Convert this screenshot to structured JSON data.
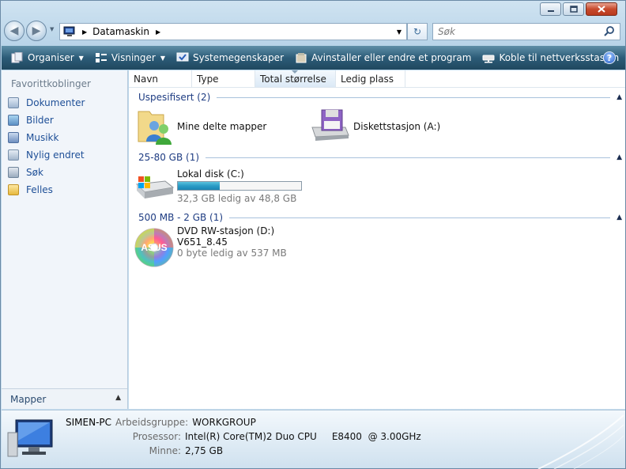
{
  "window": {
    "title": "Datamaskin"
  },
  "address": {
    "segments": [
      "Datamaskin"
    ]
  },
  "search": {
    "placeholder": "Søk"
  },
  "toolbar": {
    "organise": "Organiser",
    "views": "Visninger",
    "system_properties": "Systemegenskaper",
    "uninstall": "Avinstaller eller endre et program",
    "map_drive": "Koble til nettverksstasjon",
    "overflow": "»"
  },
  "sidebar": {
    "header": "Favorittkoblinger",
    "items": [
      {
        "label": "Dokumenter",
        "icon": "documents-icon"
      },
      {
        "label": "Bilder",
        "icon": "pictures-icon"
      },
      {
        "label": "Musikk",
        "icon": "music-icon"
      },
      {
        "label": "Nylig endret",
        "icon": "recent-icon"
      },
      {
        "label": "Søk",
        "icon": "search-icon"
      },
      {
        "label": "Felles",
        "icon": "public-folder-icon"
      }
    ],
    "folders_label": "Mapper"
  },
  "columns": [
    "Navn",
    "Type",
    "Total størrelse",
    "Ledig plass"
  ],
  "groups": [
    {
      "label": "Uspesifisert (2)",
      "items": [
        {
          "name": "Mine delte mapper",
          "icon": "shared-folder-icon"
        },
        {
          "name": "Diskettstasjon (A:)",
          "icon": "floppy-drive-icon"
        }
      ]
    },
    {
      "label": "25-80 GB (1)",
      "items": [
        {
          "name": "Lokal disk (C:)",
          "icon": "hard-disk-icon",
          "usage_fraction": 0.34,
          "free_text": "32,3 GB ledig av 48,8 GB"
        }
      ]
    },
    {
      "label": "500 MB - 2 GB (1)",
      "items": [
        {
          "name": "DVD RW-stasjon (D:)",
          "icon": "dvd-icon",
          "volume": "V651_8.45",
          "free_text": "0 byte ledig av 537 MB",
          "logo_text": "ASUS"
        }
      ]
    }
  ],
  "details": {
    "computer_name": "SIMEN-PC",
    "workgroup_label": "Arbeidsgruppe:",
    "workgroup": "WORKGROUP",
    "processor_label": "Prosessor:",
    "processor": "Intel(R) Core(TM)2 Duo CPU     E8400  @ 3.00GHz",
    "memory_label": "Minne:",
    "memory": "2,75 GB"
  },
  "colors": {
    "toolbar": "#2c5c78",
    "link": "#1e4f97",
    "group_header": "#1e3c82",
    "bar_fill": "#2a9bc6"
  }
}
